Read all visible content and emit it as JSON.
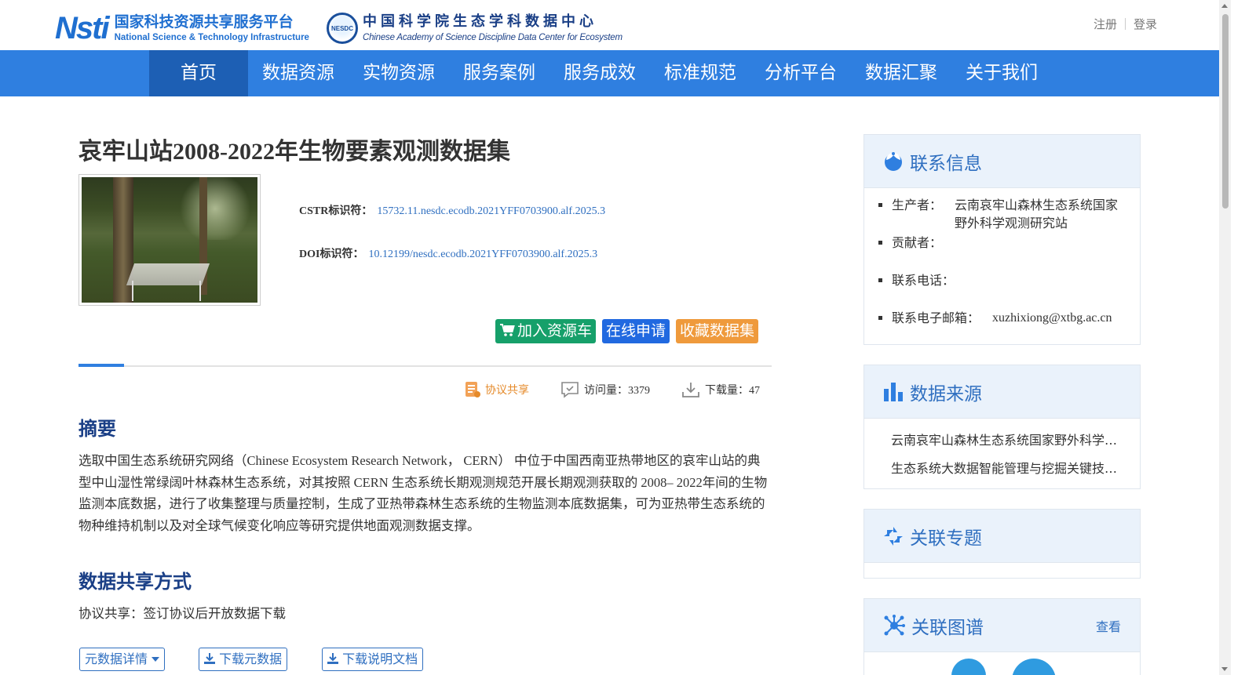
{
  "header": {
    "logo1": {
      "mark": "Nsti",
      "cn": "国家科技资源共享服务平台",
      "en": "National Science & Technology Infrastructure"
    },
    "logo2": {
      "mark": "NESDC",
      "cn": "中国科学院生态学科数据中心",
      "en": "Chinese Academy of Science Discipline Data Center for Ecosystem"
    },
    "register": "注册",
    "login": "登录"
  },
  "nav": {
    "items": [
      "首页",
      "数据资源",
      "实物资源",
      "服务案例",
      "服务成效",
      "标准规范",
      "分析平台",
      "数据汇聚",
      "关于我们"
    ],
    "active": 0
  },
  "dataset": {
    "title": "哀牢山站2008-2022年生物要素观测数据集",
    "cstr_label": "CSTR标识符：",
    "cstr_value": "15732.11.nesdc.ecodb.2021YFF0703900.alf.2025.3",
    "doi_label": "DOI标识符：",
    "doi_value": "10.12199/nesdc.ecodb.2021YFF0703900.alf.2025.3"
  },
  "actions": {
    "add_cart": "加入资源车",
    "apply_online": "在线申请",
    "favorite": "收藏数据集"
  },
  "stats": {
    "share_type": "协议共享",
    "visits": "访问量：3379",
    "downloads": "下载量：47"
  },
  "abstract": {
    "heading": "摘要",
    "text": "选取中国生态系统研究网络（Chinese Ecosystem Research Network， CERN） 中位于中国西南亚热带地区的哀牢山站的典型中山湿性常绿阔叶林森林生态系统，对其按照 CERN 生态系统长期观测规范开展长期观测获取的 2008– 2022年间的生物监测本底数据，进行了收集整理与质量控制，生成了亚热带森林生态系统的生物监测本底数据集，可为亚热带生态系统的物种维持机制以及对全球气候变化响应等研究提供地面观测数据支撑。"
  },
  "sharing": {
    "heading": "数据共享方式",
    "text": "协议共享：签订协议后开放数据下载"
  },
  "meta_buttons": {
    "details": "元数据详情",
    "download_meta": "下载元数据",
    "download_doc": "下载说明文档"
  },
  "sidebar": {
    "contact": {
      "title": "联系信息",
      "items": [
        {
          "label": "生产者：",
          "value": "云南哀牢山森林生态系统国家野外科学观测研究站"
        },
        {
          "label": "贡献者：",
          "value": ""
        },
        {
          "label": "联系电话：",
          "value": ""
        },
        {
          "label": "联系电子邮箱：",
          "value": "xuzhixiong@xtbg.ac.cn"
        }
      ]
    },
    "source": {
      "title": "数据来源",
      "items": [
        "云南哀牢山森林生态系统国家野外科学观测研究站",
        "生态系统大数据智能管理与挖掘关键技术研究"
      ]
    },
    "topic": {
      "title": "关联专题"
    },
    "graph": {
      "title": "关联图谱",
      "view": "查看"
    }
  },
  "colors": {
    "nav_bg": "#2f7fe0",
    "nav_active": "#1d5fb4",
    "btn_green": "#16a06a",
    "btn_blue": "#2169e0",
    "btn_orange": "#ef9a3c",
    "heading_blue": "#1a3f86",
    "link_blue": "#2f6fc0"
  }
}
